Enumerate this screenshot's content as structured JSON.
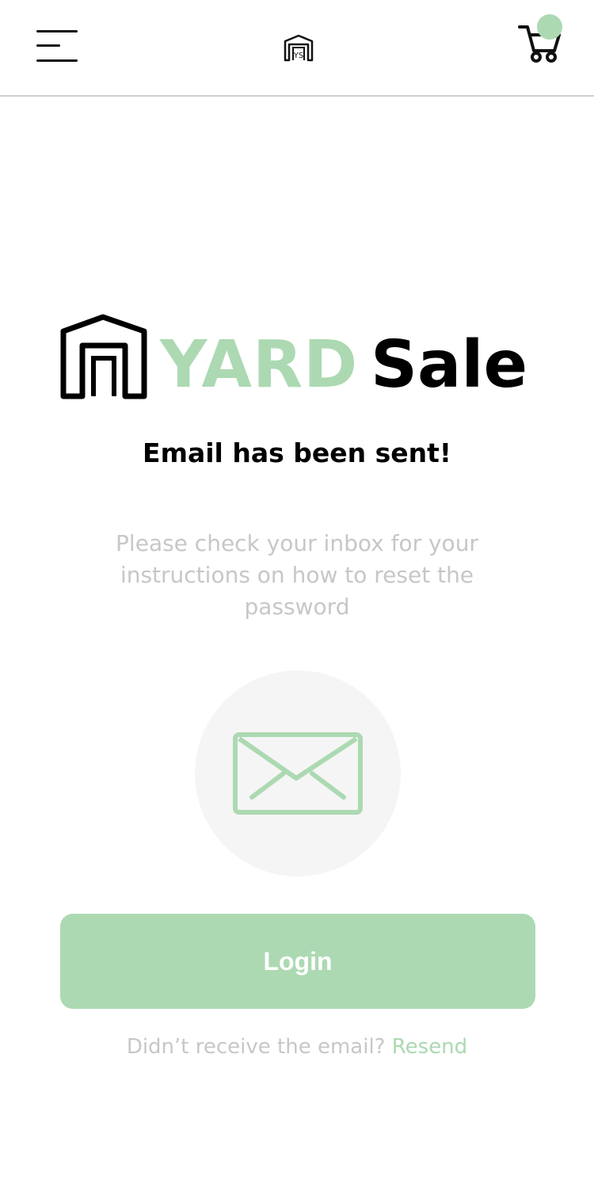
{
  "header": {
    "menu_icon": "hamburger-menu-icon",
    "logo_icon": "yard-sale-garage-logo",
    "cart_icon": "shopping-cart-icon",
    "cart_badge_color": "#acd9b2"
  },
  "brand": {
    "word1": "YARD",
    "word2": "Sale",
    "word1_color": "#acd9b2",
    "word2_color": "#000000"
  },
  "content": {
    "title": "Email has been sent!",
    "message": "Please check your inbox for your instructions on how to reset the password",
    "mail_icon": "envelope-icon",
    "login_label": "Login",
    "resend_prompt": "Didn’t receive the email?",
    "resend_link": "Resend"
  },
  "colors": {
    "accent": "#acd9b2",
    "muted_text": "#c7c7c7",
    "circle_bg": "#f5f5f5"
  }
}
